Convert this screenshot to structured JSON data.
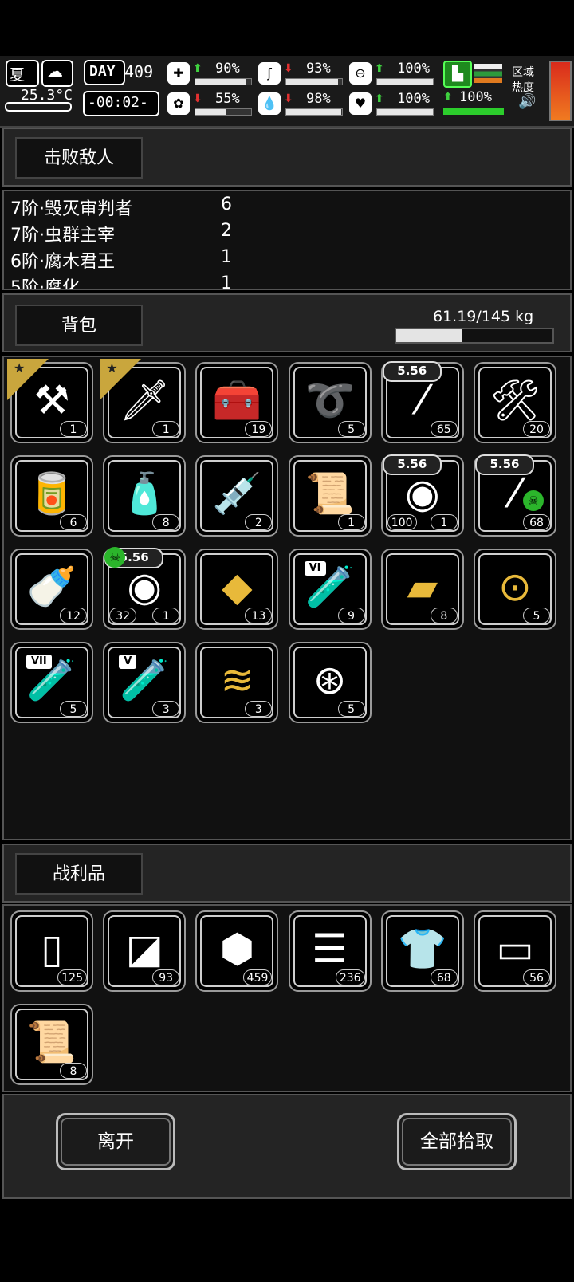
{
  "status": {
    "season": "夏",
    "temperature": "25.3°C",
    "day_label": "DAY",
    "day_number": "409",
    "clock": "-00:02-",
    "stats": [
      {
        "name": "health",
        "icon": "medkit-icon",
        "trend": "up",
        "value": "90%",
        "level": 0.9
      },
      {
        "name": "hunger",
        "icon": "stomach-icon",
        "trend": "down",
        "value": "93%",
        "level": 0.93
      },
      {
        "name": "stamina",
        "icon": "pill-icon",
        "trend": "up",
        "value": "100%",
        "level": 1.0
      },
      {
        "name": "sanity",
        "icon": "brain-icon",
        "trend": "down",
        "value": "55%",
        "level": 0.55
      },
      {
        "name": "thirst",
        "icon": "water-drop-icon",
        "trend": "down",
        "value": "98%",
        "level": 0.98
      },
      {
        "name": "mood",
        "icon": "heart-icon",
        "trend": "up",
        "value": "100%",
        "level": 1.0
      }
    ],
    "boot": {
      "value": "100%",
      "level": 1.0
    },
    "zone_heat_label_1": "区域",
    "zone_heat_label_2": "热度"
  },
  "enemies": {
    "header": "击败敌人",
    "rows": [
      {
        "name": "7阶·毁灭审判者",
        "count": "6"
      },
      {
        "name": "7阶·虫群主宰",
        "count": "2"
      },
      {
        "name": "6阶·腐木君王",
        "count": "1"
      },
      {
        "name": "5阶·腐化",
        "count": "1"
      }
    ]
  },
  "backpack": {
    "header": "背包",
    "weight": "61.19/145 kg",
    "weight_level": 0.422,
    "items": [
      {
        "icon": "shovel-icon",
        "count": "1",
        "starred": true
      },
      {
        "icon": "caliper-knife-icon",
        "count": "1",
        "starred": true
      },
      {
        "icon": "toolbox-icon",
        "count": "19"
      },
      {
        "icon": "rope-icon",
        "count": "5"
      },
      {
        "icon": "bullet-icon",
        "count": "65",
        "caliber": "5.56"
      },
      {
        "icon": "tool-cup-icon",
        "count": "20"
      },
      {
        "icon": "canned-food-icon",
        "count": "6"
      },
      {
        "icon": "water-bottle-icon",
        "count": "8"
      },
      {
        "icon": "syringe-icon",
        "count": "2"
      },
      {
        "icon": "bandage-roll-icon",
        "count": "1"
      },
      {
        "icon": "ammo-drum-icon",
        "count": "1",
        "count2": "100",
        "caliber": "5.56"
      },
      {
        "icon": "toxic-bullet-icon",
        "count": "68",
        "caliber": "5.56",
        "toxic": true
      },
      {
        "icon": "milk-bottle-icon",
        "count": "12"
      },
      {
        "icon": "toxic-ammo-drum-icon",
        "count": "1",
        "count2": "32",
        "caliber": "5.56",
        "toxic": true
      },
      {
        "icon": "gold-crystal-icon",
        "count": "13"
      },
      {
        "icon": "test-tube-icon",
        "count": "9",
        "tier": "VI"
      },
      {
        "icon": "gold-cloth-icon",
        "count": "8"
      },
      {
        "icon": "gold-pipe-icon",
        "count": "5"
      },
      {
        "icon": "test-tube-icon",
        "count": "5",
        "tier": "VII"
      },
      {
        "icon": "test-tube-icon",
        "count": "3",
        "tier": "V"
      },
      {
        "icon": "gold-coin-stack-icon",
        "count": "3"
      },
      {
        "icon": "wire-net-icon",
        "count": "5"
      }
    ]
  },
  "loot": {
    "header": "战利品",
    "items": [
      {
        "icon": "cloth-sheet-icon",
        "count": "125"
      },
      {
        "icon": "folded-cloth-icon",
        "count": "93"
      },
      {
        "icon": "rock-ore-icon",
        "count": "459"
      },
      {
        "icon": "fabric-pile-icon",
        "count": "236"
      },
      {
        "icon": "torn-shirt-icon",
        "count": "68"
      },
      {
        "icon": "rolled-fabric-icon",
        "count": "56"
      },
      {
        "icon": "paper-roll-icon",
        "count": "8"
      }
    ]
  },
  "actions": {
    "leave": "离开",
    "take_all": "全部拾取"
  }
}
